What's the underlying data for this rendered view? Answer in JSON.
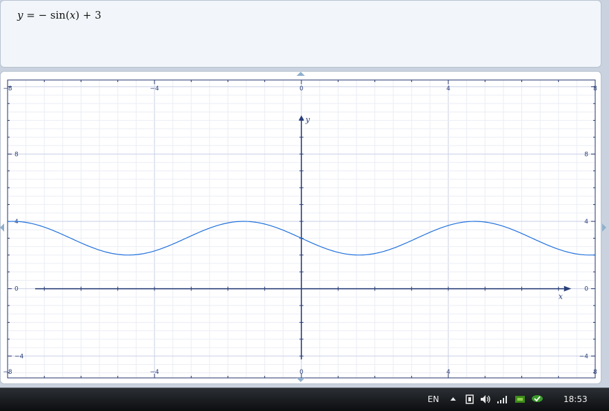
{
  "formula": {
    "lhs": "y",
    "rhs_prefix": " = − sin(",
    "arg": "x",
    "rhs_suffix": ") + 3"
  },
  "chart_data": {
    "type": "line",
    "title": "",
    "xlabel": "x",
    "ylabel": "y",
    "xlim": [
      -8,
      8
    ],
    "ylim": [
      -5.3,
      12.4
    ],
    "x_ticks": [
      -8,
      -4,
      0,
      4,
      8
    ],
    "y_ticks": [
      -4,
      0,
      4,
      8
    ],
    "x_tick_labels": [
      "−8",
      "−4",
      "0",
      "4",
      "8"
    ],
    "y_tick_labels": [
      "−4",
      "0",
      "4",
      "8"
    ],
    "grid": true,
    "series": [
      {
        "function": "y = -sin(x) + 3",
        "color": "#1e6fdc",
        "x": [
          -8,
          -7,
          -6,
          -5,
          -4.712,
          -4,
          -3,
          -2,
          -1.571,
          -1,
          0,
          1,
          1.571,
          2,
          3,
          4,
          4.712,
          5,
          6,
          7,
          8
        ],
        "y": [
          3.99,
          3.66,
          2.72,
          2.04,
          2.0,
          2.24,
          3.14,
          3.91,
          4.0,
          3.84,
          3.0,
          2.16,
          2.0,
          2.09,
          2.86,
          3.76,
          4.0,
          3.96,
          3.28,
          2.34,
          2.01
        ]
      }
    ]
  },
  "colors": {
    "axis": "#2a3f7a",
    "frame": "#20306a",
    "grid_major": "#c9cfe6",
    "grid_minor": "#ebedf5",
    "curve": "#1e6fdc"
  },
  "taskbar": {
    "language": "EN",
    "clock": "18:53",
    "tray_icons": [
      "show-hidden-icons-arrow",
      "network-icon",
      "volume-icon",
      "signal-bars-icon",
      "nvidia-icon",
      "security-icon"
    ]
  }
}
